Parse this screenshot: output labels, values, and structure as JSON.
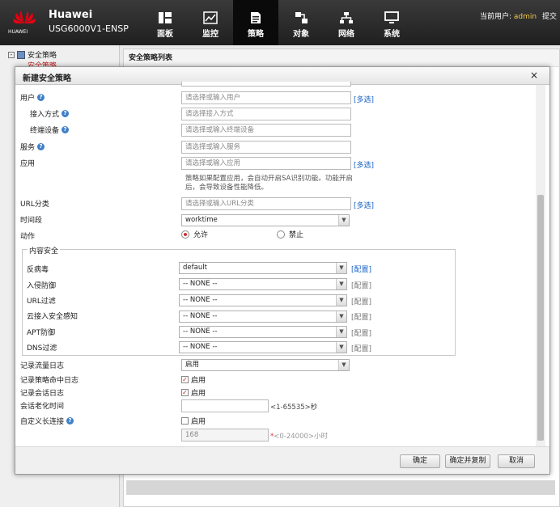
{
  "header": {
    "logo_text": "HUAWEI",
    "brand": "Huawei",
    "model": "USG6000V1-ENSP",
    "nav": [
      "面板",
      "监控",
      "策略",
      "对象",
      "网络",
      "系统"
    ],
    "user_label": "当前用户:",
    "username": "admin",
    "submit": "提交"
  },
  "sidebar": {
    "root": "安全策略",
    "child": "安全策略"
  },
  "main": {
    "title": "安全策略列表"
  },
  "dialog": {
    "title": "新建安全策略",
    "close": "×",
    "user": {
      "label": "用户",
      "placeholder": "请选择或输入用户",
      "link": "[多选]"
    },
    "access": {
      "label": "接入方式",
      "placeholder": "请选择接入方式"
    },
    "terminal": {
      "label": "终端设备",
      "placeholder": "请选择或输入终端设备"
    },
    "service": {
      "label": "服务",
      "placeholder": "请选择或输入服务"
    },
    "app": {
      "label": "应用",
      "placeholder": "请选择或输入应用",
      "link": "[多选]"
    },
    "app_note": "策略如果配置应用，会自动开启SA识别功能。功能开启后，会导致设备性能降低。",
    "url": {
      "label": "URL分类",
      "placeholder": "请选择或输入URL分类",
      "link": "[多选]"
    },
    "time": {
      "label": "时间段",
      "value": "worktime"
    },
    "action": {
      "label": "动作",
      "permit": "允许",
      "deny": "禁止"
    },
    "content_security": {
      "legend": "内容安全",
      "rows": [
        {
          "label": "反病毒",
          "value": "default",
          "link": "[配置]"
        },
        {
          "label": "入侵防御",
          "value": "-- NONE --",
          "link": "[配置]"
        },
        {
          "label": "URL过滤",
          "value": "-- NONE --",
          "link": "[配置]"
        },
        {
          "label": "云接入安全感知",
          "value": "-- NONE --",
          "link": "[配置]"
        },
        {
          "label": "APT防御",
          "value": "-- NONE --",
          "link": "[配置]"
        },
        {
          "label": "DNS过滤",
          "value": "-- NONE --",
          "link": "[配置]"
        }
      ]
    },
    "traffic_log": {
      "label": "记录流量日志",
      "value": "启用"
    },
    "policy_log": {
      "label": "记录策略命中日志",
      "check": "启用"
    },
    "session_log": {
      "label": "记录会话日志",
      "check": "启用"
    },
    "aging": {
      "label": "会话老化时间",
      "hint": "<1-65535>秒"
    },
    "long_conn": {
      "label": "自定义长连接",
      "check": "启用",
      "value": "168",
      "star": "*",
      "hint": "<0-24000>小时"
    },
    "buttons": {
      "ok": "确定",
      "ok_copy": "确定并复制",
      "cancel": "取消"
    }
  },
  "colors": {
    "topbar": "#2b2b2b",
    "link": "#1762c5",
    "accent_red": "#d03030",
    "username": "#f2c84a"
  }
}
